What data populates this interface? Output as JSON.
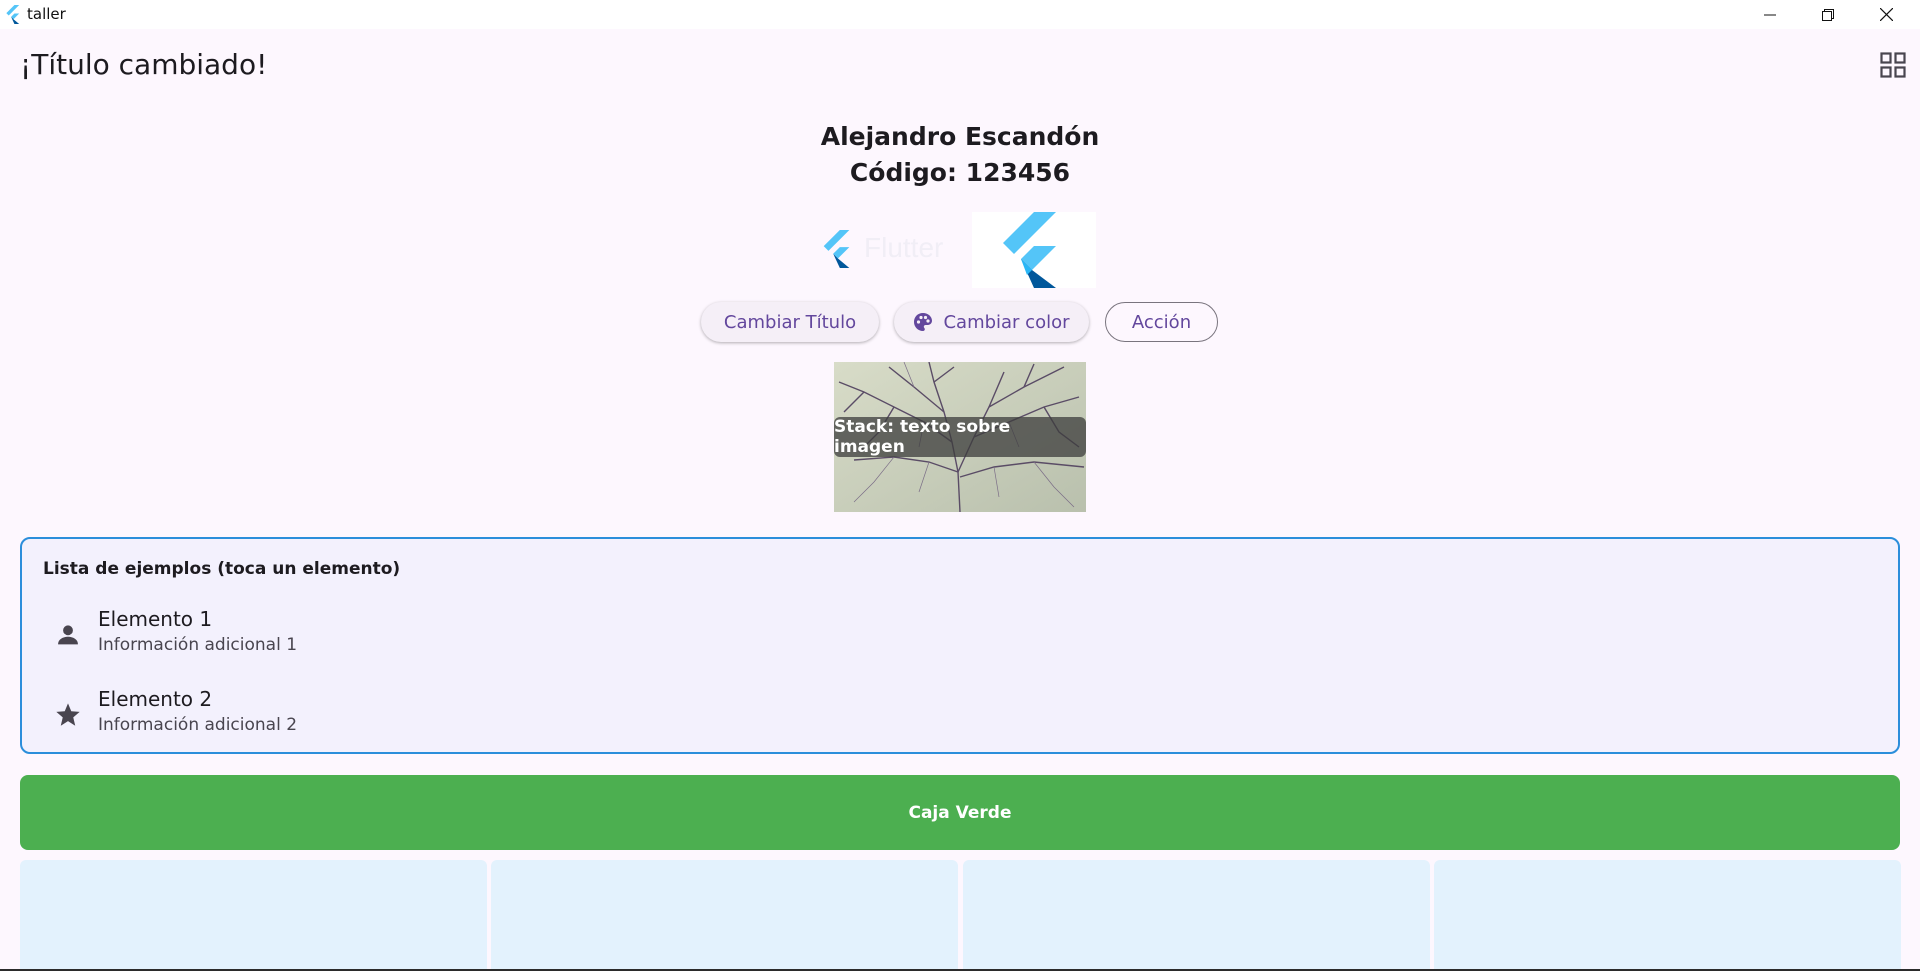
{
  "window": {
    "title": "taller"
  },
  "appbar": {
    "title": "¡Título cambiado!"
  },
  "header": {
    "name": "Alejandro Escandón",
    "code": "Código: 123456"
  },
  "logo": {
    "text": "Flutter"
  },
  "buttons": {
    "change_title": "Cambiar Título",
    "change_color": "Cambiar color",
    "action": "Acción"
  },
  "stack": {
    "label": "Stack: texto sobre imagen"
  },
  "list": {
    "title": "Lista de ejemplos (toca un elemento)",
    "items": [
      {
        "title": "Elemento 1",
        "subtitle": "Información adicional 1",
        "icon": "person-icon"
      },
      {
        "title": "Elemento 2",
        "subtitle": "Información adicional 2",
        "icon": "star-icon"
      }
    ]
  },
  "green_box": {
    "label": "Caja Verde"
  },
  "colors": {
    "background": "#fdf7fe",
    "primary": "#63479d",
    "list_border": "#2b8edb",
    "green": "#4caf50",
    "tile": "#e3f2fd"
  }
}
